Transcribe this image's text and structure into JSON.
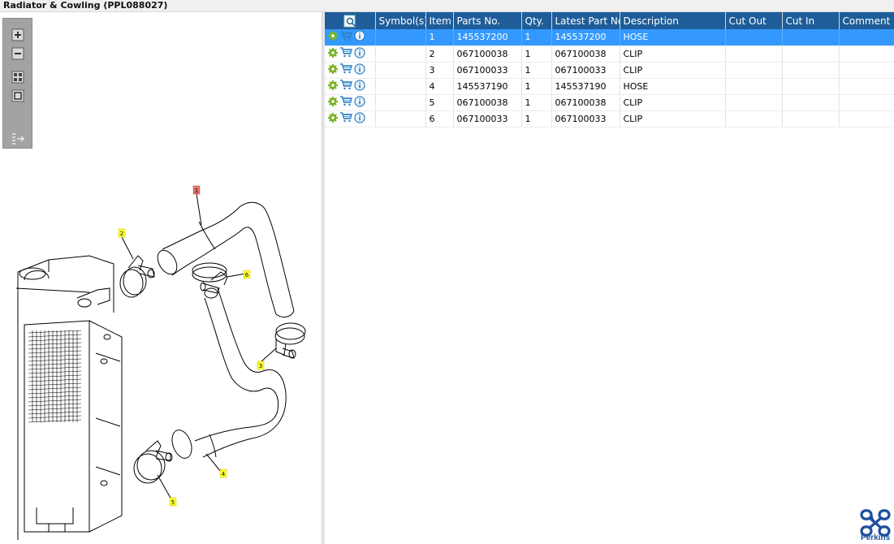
{
  "window": {
    "title": "Radiator & Cowling (PPL088027)"
  },
  "toolbar": {
    "buttons": [
      "zoom-in",
      "zoom-out",
      "fit-all",
      "fit-page",
      "toggle-list"
    ]
  },
  "diagram": {
    "callouts": [
      "1",
      "2",
      "3",
      "4",
      "5",
      "6"
    ],
    "callout_colors": {
      "selected": "#e57373",
      "normal": "#ffff33"
    }
  },
  "table": {
    "columns": [
      "",
      "Symbol(s)",
      "Item",
      "Parts No.",
      "Qty.",
      "Latest Part No.",
      "Description",
      "Cut Out",
      "Cut In",
      "Comment"
    ],
    "rows": [
      {
        "symbols": "",
        "item": "1",
        "part_no": "145537200",
        "qty": "1",
        "latest_part_no": "145537200",
        "description": "HOSE",
        "cut_out": "",
        "cut_in": "",
        "comment": ""
      },
      {
        "symbols": "",
        "item": "2",
        "part_no": "067100038",
        "qty": "1",
        "latest_part_no": "067100038",
        "description": "CLIP",
        "cut_out": "",
        "cut_in": "",
        "comment": ""
      },
      {
        "symbols": "",
        "item": "3",
        "part_no": "067100033",
        "qty": "1",
        "latest_part_no": "067100033",
        "description": "CLIP",
        "cut_out": "",
        "cut_in": "",
        "comment": ""
      },
      {
        "symbols": "",
        "item": "4",
        "part_no": "145537190",
        "qty": "1",
        "latest_part_no": "145537190",
        "description": "HOSE",
        "cut_out": "",
        "cut_in": "",
        "comment": ""
      },
      {
        "symbols": "",
        "item": "5",
        "part_no": "067100038",
        "qty": "1",
        "latest_part_no": "067100038",
        "description": "CLIP",
        "cut_out": "",
        "cut_in": "",
        "comment": ""
      },
      {
        "symbols": "",
        "item": "6",
        "part_no": "067100033",
        "qty": "1",
        "latest_part_no": "067100033",
        "description": "CLIP",
        "cut_out": "",
        "cut_in": "",
        "comment": ""
      }
    ],
    "selected_row": 0,
    "row_icons": [
      "gear-icon",
      "cart-icon",
      "info-icon"
    ]
  },
  "brand": {
    "name": "Perkins",
    "color": "#1d4f9c"
  },
  "colors": {
    "header": "#1e5d99",
    "selection": "#3399ff",
    "toolbar": "#a3a3a3"
  }
}
